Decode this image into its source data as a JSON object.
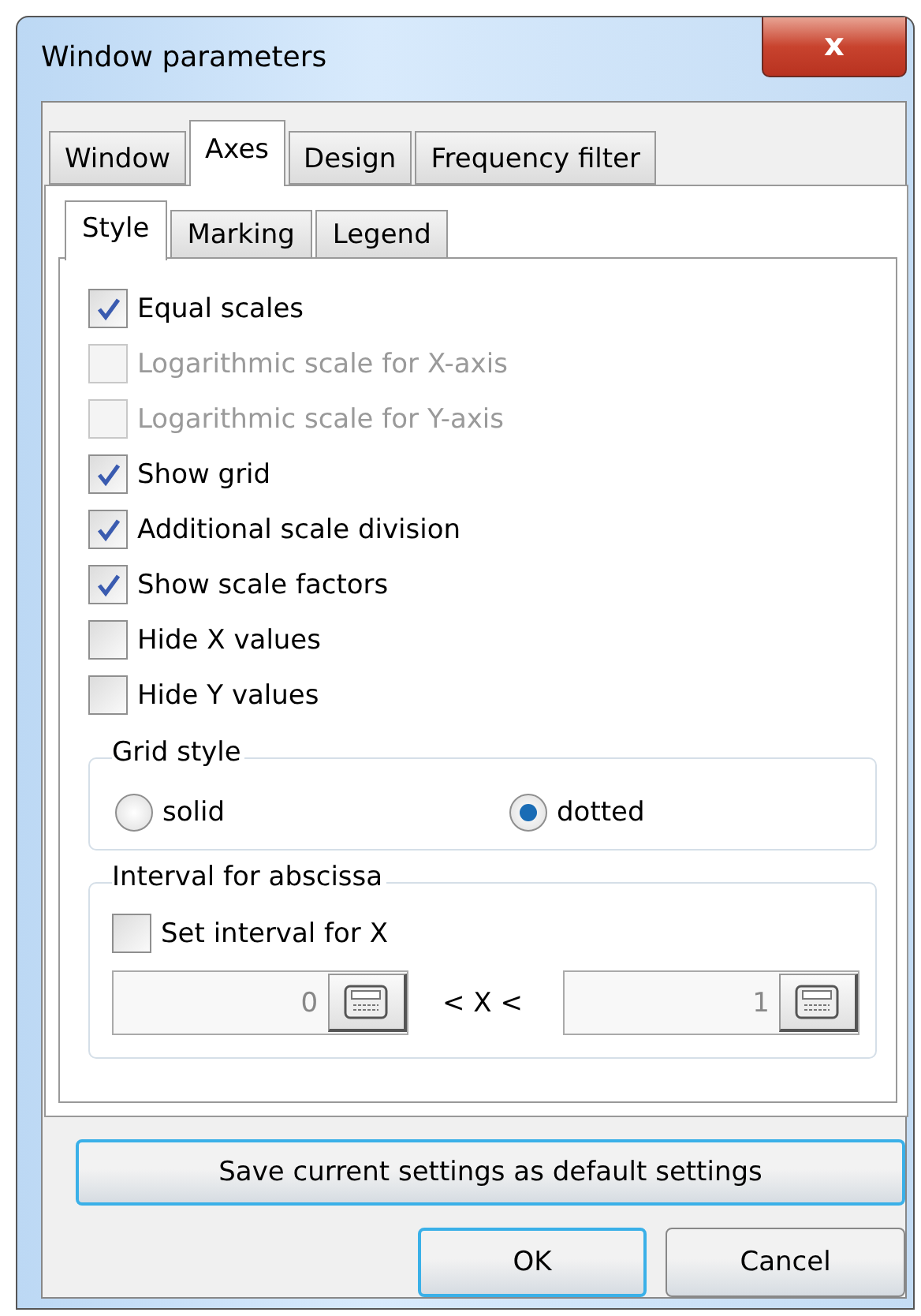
{
  "window": {
    "title": "Window parameters",
    "close": "x"
  },
  "tabs": [
    {
      "label": "Window",
      "selected": false
    },
    {
      "label": "Axes",
      "selected": true
    },
    {
      "label": "Design",
      "selected": false
    },
    {
      "label": "Frequency filter",
      "selected": false
    }
  ],
  "subtabs": [
    {
      "label": "Style",
      "selected": true
    },
    {
      "label": "Marking",
      "selected": false
    },
    {
      "label": "Legend",
      "selected": false
    }
  ],
  "options": [
    {
      "label": "Equal scales",
      "checked": true,
      "disabled": false
    },
    {
      "label": "Logarithmic scale for X-axis",
      "checked": false,
      "disabled": true
    },
    {
      "label": "Logarithmic scale for Y-axis",
      "checked": false,
      "disabled": true
    },
    {
      "label": "Show grid",
      "checked": true,
      "disabled": false
    },
    {
      "label": "Additional scale division",
      "checked": true,
      "disabled": false
    },
    {
      "label": "Show scale factors",
      "checked": true,
      "disabled": false
    },
    {
      "label": "Hide X values",
      "checked": false,
      "disabled": false
    },
    {
      "label": "Hide Y values",
      "checked": false,
      "disabled": false
    }
  ],
  "grid_style": {
    "title": "Grid style",
    "options": [
      {
        "label": "solid",
        "selected": false
      },
      {
        "label": "dotted",
        "selected": true
      }
    ]
  },
  "interval": {
    "title": "Interval for abscissa",
    "checkbox": {
      "label": "Set interval for X",
      "checked": false
    },
    "from": "0",
    "separator": "< X <",
    "to": "1"
  },
  "save_button": "Save current settings as default settings",
  "buttons": [
    {
      "label": "OK",
      "kind": "default"
    },
    {
      "label": "Cancel",
      "kind": "normal"
    }
  ]
}
